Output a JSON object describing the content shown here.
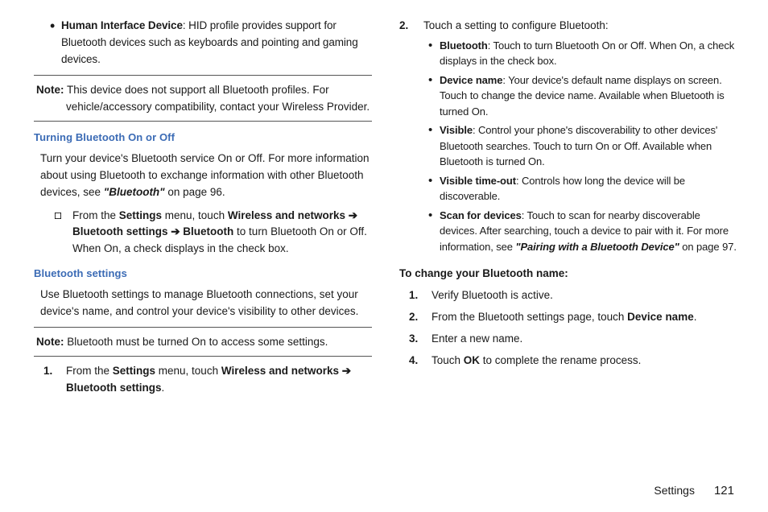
{
  "left": {
    "bullet1_prefix": "Human Interface Device",
    "bullet1_rest": ": HID profile provides support for Bluetooth devices such as keyboards and pointing and gaming devices.",
    "note1_label": "Note:",
    "note1_body": " This device does not support all Bluetooth profiles. For vehicle/accessory compatibility, contact your Wireless Provider.",
    "h1": "Turning Bluetooth On or Off",
    "p1a": "Turn your device's Bluetooth service On or Off. For more information about using Bluetooth to exchange information with other Bluetooth devices, see ",
    "p1b": "\"Bluetooth\"",
    "p1c": " on page 96.",
    "sq1a": "From the ",
    "sq1b": "Settings",
    "sq1c": " menu, touch ",
    "sq1d": "Wireless and networks ➔ Bluetooth settings ➔ Bluetooth",
    "sq1e": " to turn Bluetooth On or Off. When On, a check displays in the check box.",
    "h2": "Bluetooth settings",
    "p2": "Use Bluetooth settings to manage Bluetooth connections, set your device's name, and control your device's visibility to other devices.",
    "note2_label": "Note:",
    "note2_body": " Bluetooth must be turned On to access some settings.",
    "n1_num": "1.",
    "n1a": "From the ",
    "n1b": "Settings",
    "n1c": " menu, touch ",
    "n1d": "Wireless and networks ➔ Bluetooth settings",
    "n1e": "."
  },
  "right": {
    "n2_num": "2.",
    "n2_lead": "Touch a setting to configure Bluetooth:",
    "sb": [
      {
        "b": "Bluetooth",
        "t": ": Touch to turn Bluetooth On or Off. When On, a check displays in the check box."
      },
      {
        "b": "Device name",
        "t": ": Your device's default name displays on screen. Touch to change the device name. Available when Bluetooth is turned On."
      },
      {
        "b": "Visible",
        "t": ": Control your phone's discoverability to other devices' Bluetooth searches. Touch to turn On or Off. Available when Bluetooth is turned On."
      },
      {
        "b": "Visible time-out",
        "t": ": Controls how long the device will be discoverable."
      },
      {
        "b": "Scan for devices",
        "t": ": Touch to scan for nearby discoverable devices. After searching, touch a device to pair with it. For more information, see "
      }
    ],
    "sb5_ital": "\"Pairing with a Bluetooth Device\"",
    "sb5_tail": " on page 97.",
    "head2": "To change your Bluetooth name:",
    "steps": [
      {
        "n": "1.",
        "t": "Verify Bluetooth is active."
      },
      {
        "n": "2.",
        "a": "From the Bluetooth settings page, touch ",
        "b": "Device name",
        "c": "."
      },
      {
        "n": "3.",
        "t": "Enter a new name."
      },
      {
        "n": "4.",
        "a": "Touch ",
        "b": "OK",
        "c": " to complete the rename process."
      }
    ]
  },
  "footer": {
    "section": "Settings",
    "page": "121"
  }
}
